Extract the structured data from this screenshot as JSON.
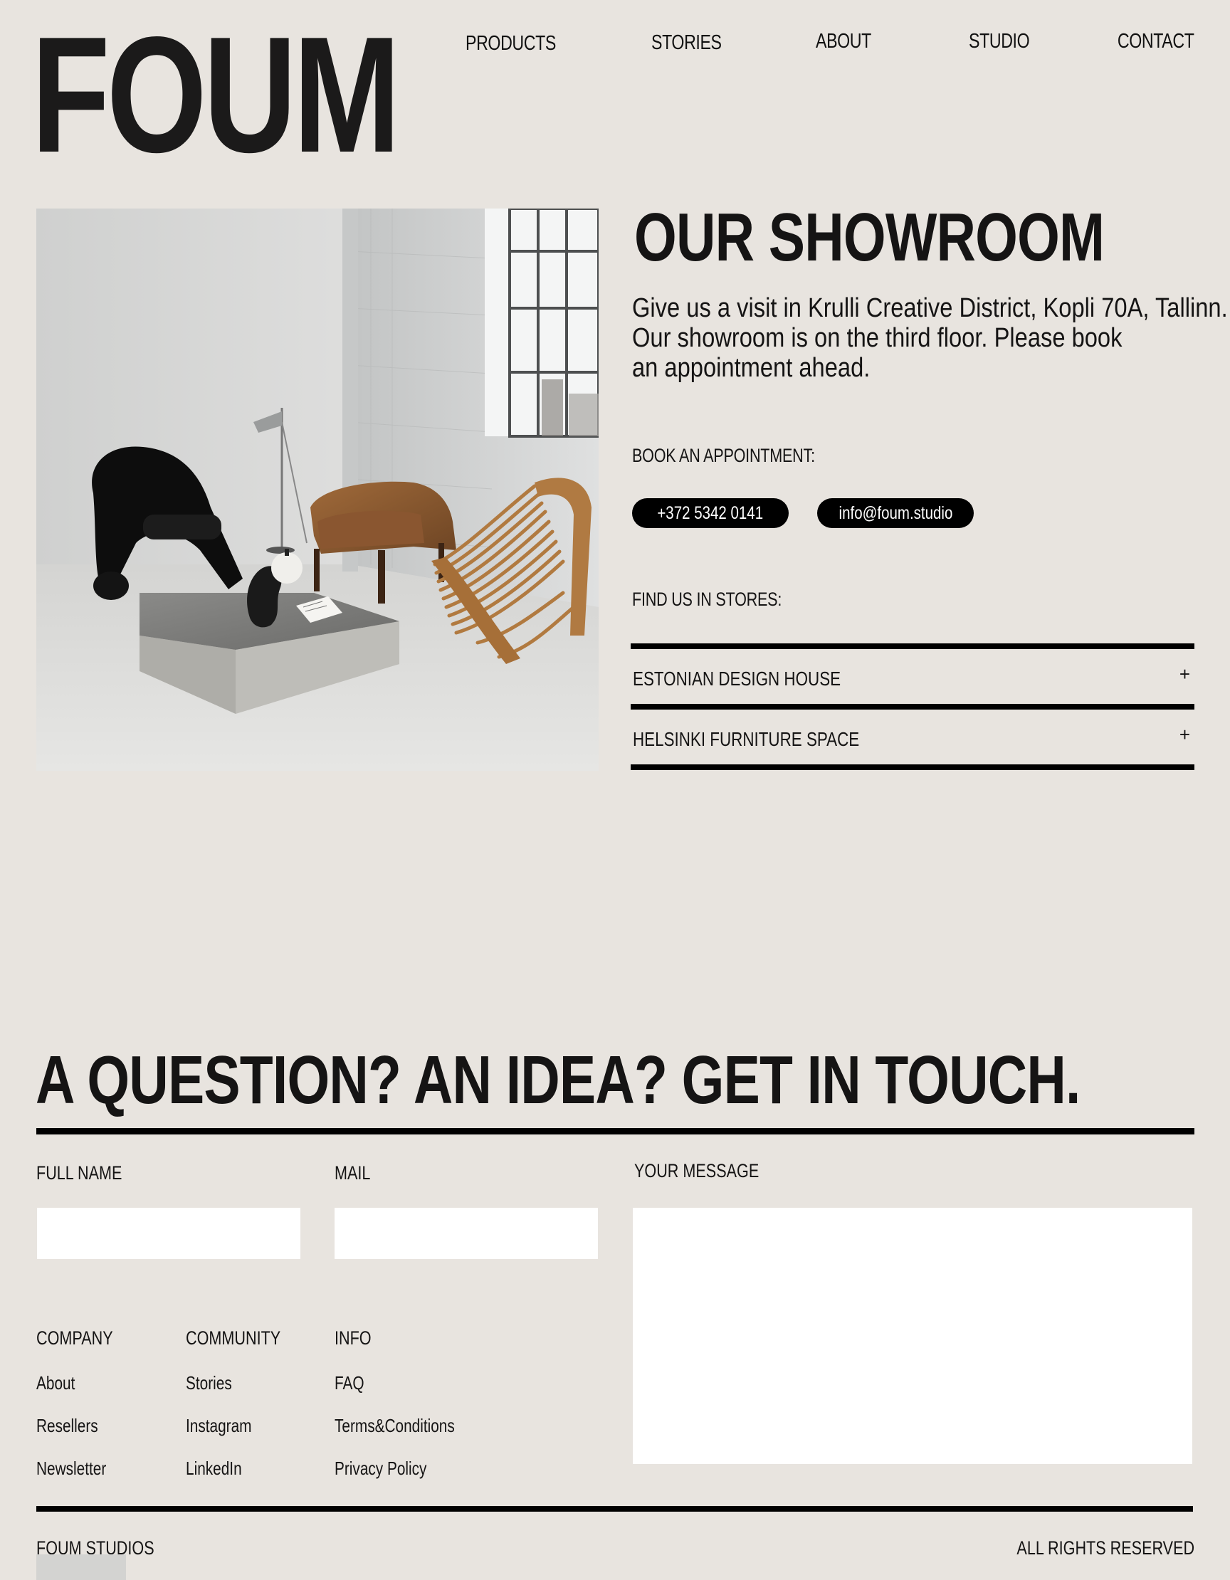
{
  "brand": {
    "logo": "FOUM"
  },
  "nav": {
    "items": [
      {
        "label": "PRODUCTS"
      },
      {
        "label": "STORIES"
      },
      {
        "label": "ABOUT"
      },
      {
        "label": "STUDIO"
      },
      {
        "label": "CONTACT"
      }
    ]
  },
  "showroom": {
    "title": "OUR SHOWROOM",
    "description_lines": [
      "Give us a visit in Krulli Creative District, Kopli 70A, Tallinn.",
      "Our showroom is on the third floor. Please book",
      "an appointment ahead."
    ],
    "appointment_label": "BOOK AN APPOINTMENT:",
    "phone": "+372 5342 0141",
    "email": "info@foum.studio",
    "stores_label": "FIND US IN STORES:",
    "stores": [
      {
        "name": "ESTONIAN DESIGN HOUSE",
        "icon": "plus-icon",
        "expand_symbol": "+"
      },
      {
        "name": "HELSINKI FURNITURE SPACE",
        "icon": "plus-icon",
        "expand_symbol": "+"
      }
    ]
  },
  "contact": {
    "title": "A QUESTION? AN IDEA? GET IN TOUCH.",
    "full_name_label": "FULL NAME",
    "full_name_value": "",
    "mail_label": "MAIL",
    "mail_value": "",
    "message_label": "YOUR MESSAGE",
    "message_value": ""
  },
  "footer": {
    "columns": [
      {
        "heading": "COMPANY",
        "links": [
          "About",
          "Resellers",
          "Newsletter"
        ]
      },
      {
        "heading": "COMMUNITY",
        "links": [
          "Stories",
          "Instagram",
          "LinkedIn"
        ]
      },
      {
        "heading": "INFO",
        "links": [
          "FAQ",
          "Terms&Conditions",
          "Privacy Policy"
        ]
      }
    ],
    "company_name": "FOUM STUDIOS",
    "rights": "ALL RIGHTS RESERVED"
  },
  "colors": {
    "background": "#e8e4df",
    "text": "#151414",
    "pill_bg": "#000000",
    "pill_text": "#ffffff",
    "field_bg": "#ffffff"
  }
}
